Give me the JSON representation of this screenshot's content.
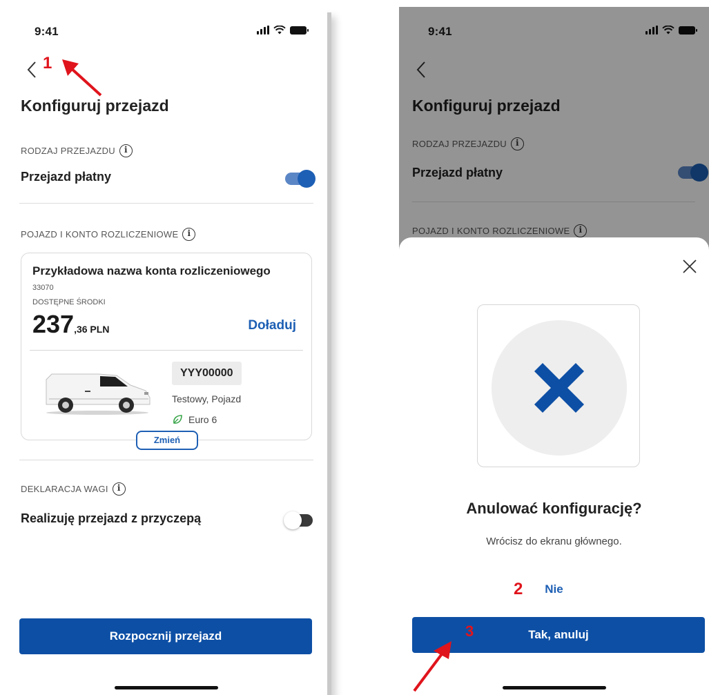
{
  "status": {
    "time": "9:41"
  },
  "config": {
    "title": "Konfiguruj przejazd",
    "ride_type_label": "RODZAJ PRZEJAZDU",
    "paid_ride_label": "Przejazd płatny",
    "paid_ride_enabled": true,
    "vehicle_section_label": "POJAZD I KONTO ROZLICZENIOWE",
    "account": {
      "name": "Przykładowa nazwa konta rozliczeniowego",
      "number": "33070",
      "funds_label": "DOSTĘPNE ŚRODKI",
      "amount_integer": "237",
      "amount_fraction": ",36 PLN",
      "topup_label": "Doładuj"
    },
    "vehicle": {
      "plate": "YYY00000",
      "name": "Testowy, Pojazd",
      "emission": "Euro 6",
      "change_label": "Zmień"
    },
    "weight_section_label": "DEKLARACJA WAGI",
    "trailer_label": "Realizuję przejazd z przyczepą",
    "trailer_enabled": false,
    "start_button": "Rozpocznij przejazd"
  },
  "dialog": {
    "title": "Anulować konfigurację?",
    "subtitle": "Wrócisz do ekranu głównego.",
    "no_label": "Nie",
    "yes_label": "Tak, anuluj"
  },
  "annotations": {
    "a1": "1",
    "a2": "2",
    "a3": "3"
  },
  "colors": {
    "brand_blue": "#0d4fa5",
    "link_blue": "#1d5fb4",
    "annotation_red": "#e0141c",
    "eco_green": "#3aa64a"
  },
  "icons": [
    "back-chevron-icon",
    "info-icon",
    "signal-icon",
    "wifi-icon",
    "battery-icon",
    "leaf-icon",
    "close-icon",
    "cross-icon",
    "van-image"
  ]
}
